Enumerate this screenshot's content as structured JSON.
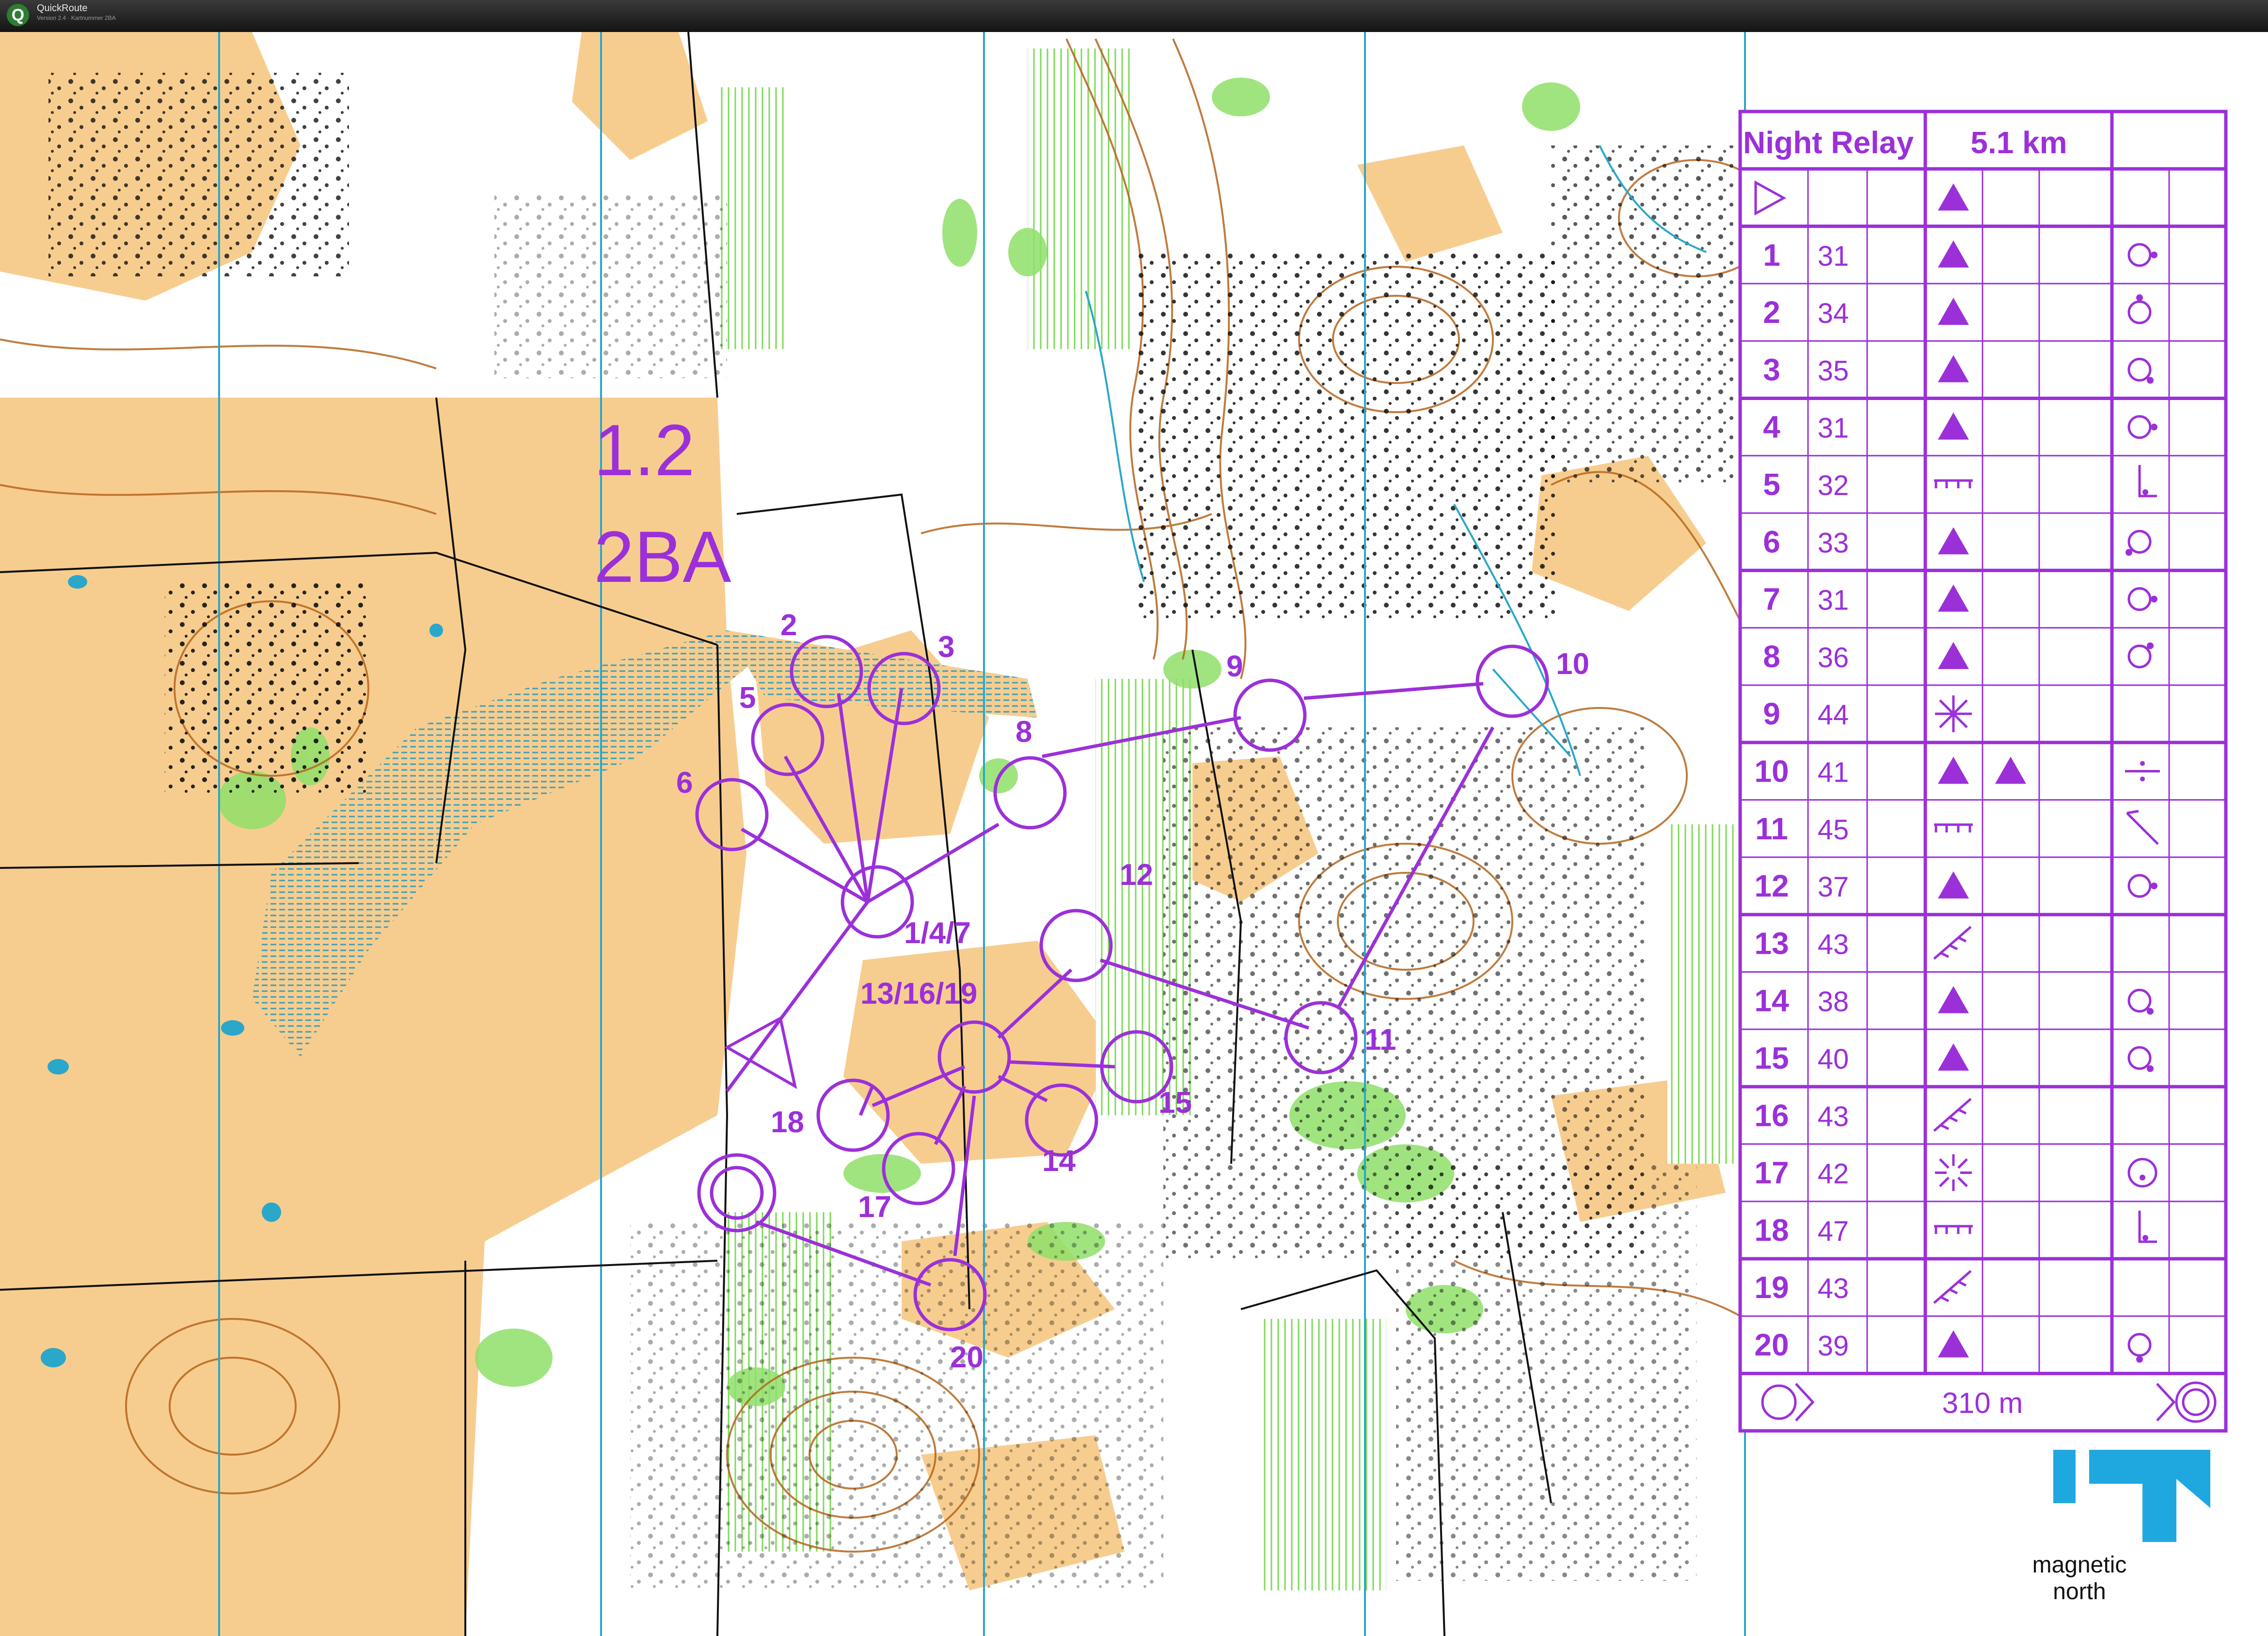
{
  "window": {
    "title": "QuickRoute",
    "subtitle": "Version 2.4  ·  Kartnummer 2BA"
  },
  "map": {
    "sheet_labels": [
      "1.2",
      "2BA"
    ],
    "colors": {
      "course": "#9b30d9",
      "open_land": "#f7cd8f",
      "forest": "#ffffff",
      "green": "#7ed957",
      "contour": "#b5651d",
      "water": "#2aa7c9",
      "north_logo": "#1fa8e0"
    },
    "controls": [
      {
        "label": "2"
      },
      {
        "label": "3"
      },
      {
        "label": "5"
      },
      {
        "label": "6"
      },
      {
        "label": "8"
      },
      {
        "label": "9"
      },
      {
        "label": "10"
      },
      {
        "label": "1/4/7"
      },
      {
        "label": "12"
      },
      {
        "label": "13/16/19"
      },
      {
        "label": "11"
      },
      {
        "label": "15"
      },
      {
        "label": "18"
      },
      {
        "label": "14"
      },
      {
        "label": "17"
      },
      {
        "label": "20"
      }
    ],
    "north_label": "magnetic north"
  },
  "description": {
    "title": "Night Relay",
    "length": "5.1 km",
    "finish_distance": "310 m",
    "rows": [
      {
        "no": "1",
        "code": "31",
        "feature": "knoll",
        "extra": "",
        "pos": "east"
      },
      {
        "no": "2",
        "code": "34",
        "feature": "knoll",
        "extra": "",
        "pos": "north"
      },
      {
        "no": "3",
        "code": "35",
        "feature": "knoll",
        "extra": "",
        "pos": "southeast"
      },
      {
        "no": "4",
        "code": "31",
        "feature": "knoll",
        "extra": "",
        "pos": "east"
      },
      {
        "no": "5",
        "code": "32",
        "feature": "cliff",
        "extra": "",
        "pos": "foot"
      },
      {
        "no": "6",
        "code": "33",
        "feature": "knoll",
        "extra": "",
        "pos": "southwest"
      },
      {
        "no": "7",
        "code": "31",
        "feature": "knoll",
        "extra": "",
        "pos": "east"
      },
      {
        "no": "8",
        "code": "36",
        "feature": "knoll",
        "extra": "",
        "pos": "northeast"
      },
      {
        "no": "9",
        "code": "44",
        "feature": "special",
        "extra": "",
        "pos": ""
      },
      {
        "no": "10",
        "code": "41",
        "feature": "knoll",
        "extra": "knoll",
        "pos": "between"
      },
      {
        "no": "11",
        "code": "45",
        "feature": "cliff",
        "extra": "",
        "pos": "corner"
      },
      {
        "no": "12",
        "code": "37",
        "feature": "knoll",
        "extra": "",
        "pos": "east"
      },
      {
        "no": "13",
        "code": "43",
        "feature": "rockface",
        "extra": "",
        "pos": ""
      },
      {
        "no": "14",
        "code": "38",
        "feature": "knoll",
        "extra": "",
        "pos": "southeast"
      },
      {
        "no": "15",
        "code": "40",
        "feature": "knoll",
        "extra": "",
        "pos": "southeast"
      },
      {
        "no": "16",
        "code": "43",
        "feature": "rockface",
        "extra": "",
        "pos": ""
      },
      {
        "no": "17",
        "code": "42",
        "feature": "special2",
        "extra": "",
        "pos": "part"
      },
      {
        "no": "18",
        "code": "47",
        "feature": "cliff",
        "extra": "",
        "pos": "foot"
      },
      {
        "no": "19",
        "code": "43",
        "feature": "rockface",
        "extra": "",
        "pos": ""
      },
      {
        "no": "20",
        "code": "39",
        "feature": "knoll",
        "extra": "",
        "pos": "south"
      }
    ]
  }
}
